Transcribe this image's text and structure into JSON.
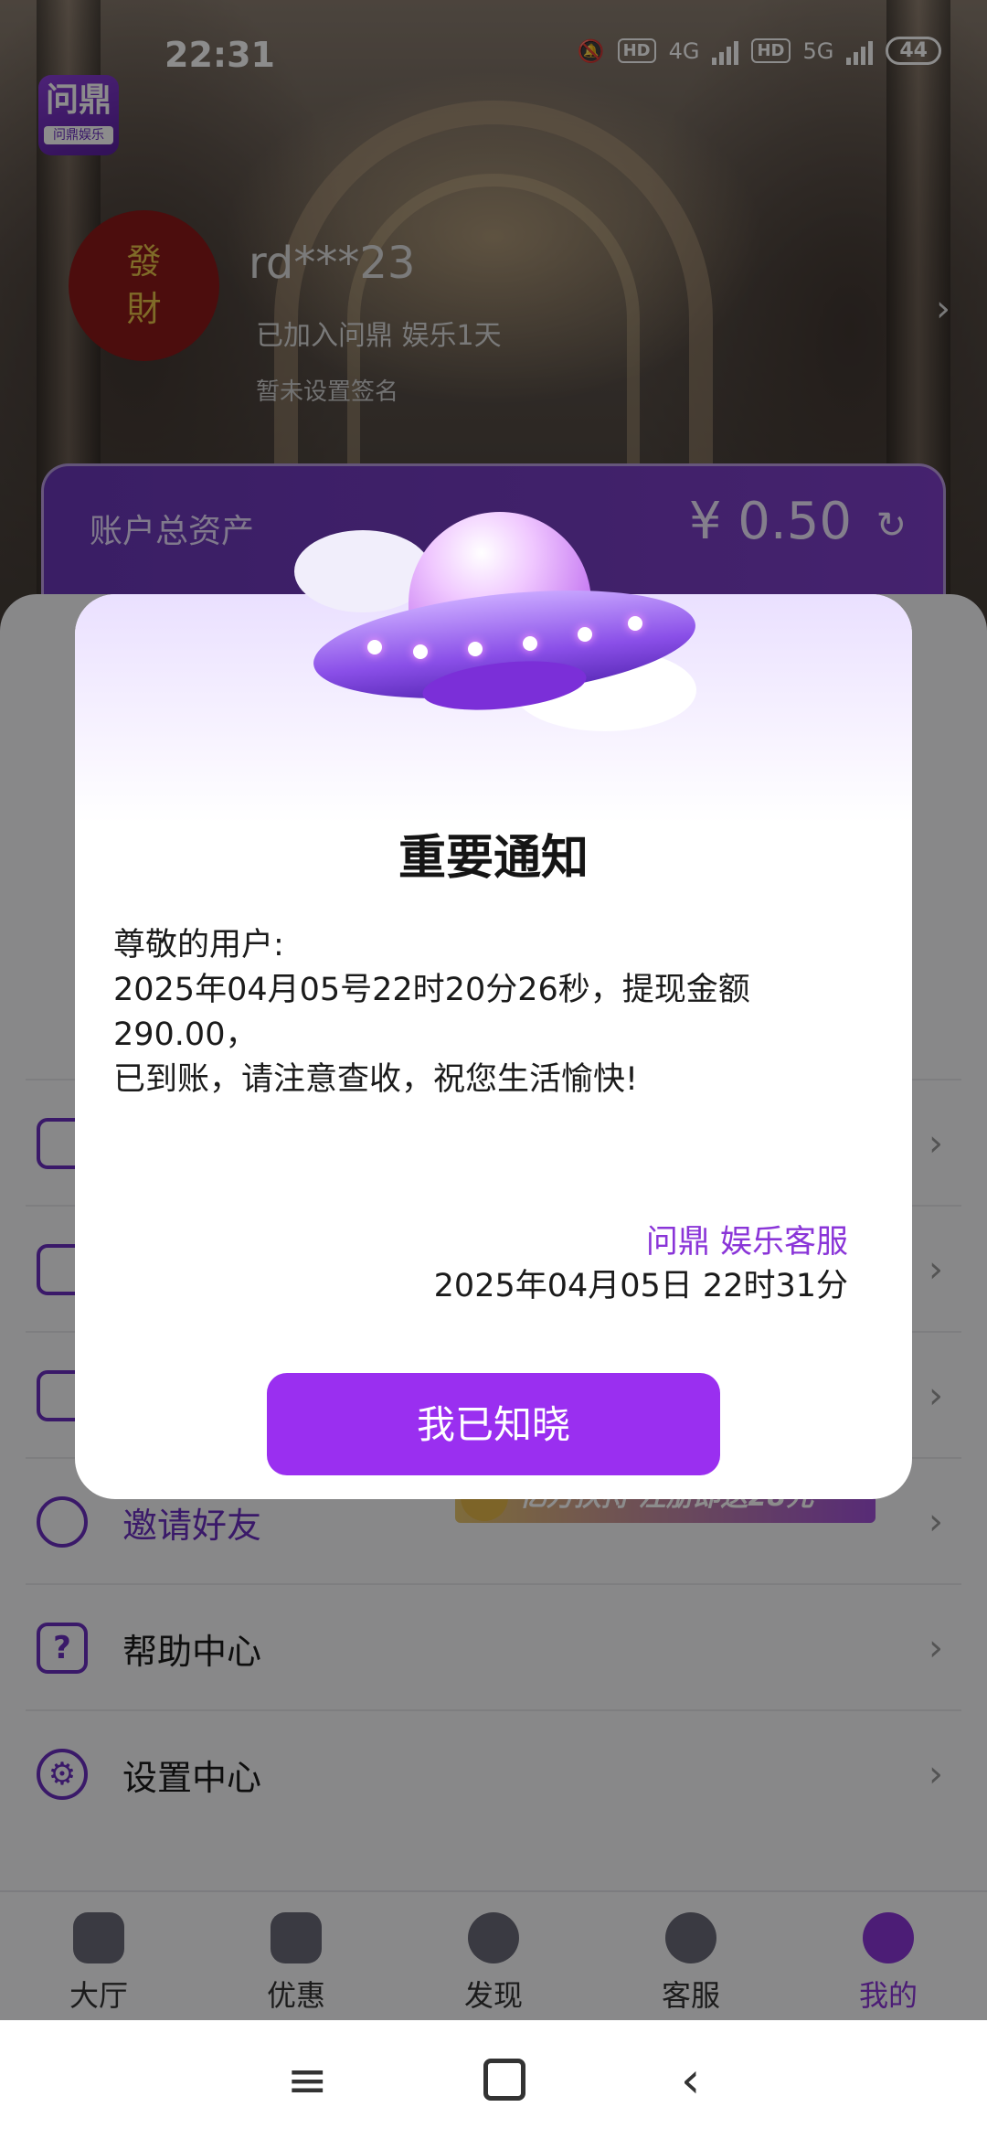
{
  "status_bar": {
    "time": "22:31",
    "hd1": "HD",
    "net1": "4G",
    "hd2": "HD",
    "net2": "5G",
    "battery": "44"
  },
  "app": {
    "logo_main": "问鼎",
    "logo_sub": "问鼎娱乐"
  },
  "profile": {
    "avatar_text": "發財",
    "username": "rd***23",
    "joined": "已加入问鼎 娱乐1天",
    "signature": "暂未设置签名"
  },
  "assets": {
    "label": "账户总资产",
    "value": "¥ 0.50"
  },
  "menu": {
    "invite_label": "邀请好友",
    "invite_banner": "亿万扶持 注册即送28元",
    "help_label": "帮助中心",
    "settings_label": "设置中心"
  },
  "tabs": [
    {
      "label": "大厅"
    },
    {
      "label": "优惠"
    },
    {
      "label": "发现"
    },
    {
      "label": "客服"
    },
    {
      "label": "我的"
    }
  ],
  "dialog": {
    "title": "重要通知",
    "greeting": "尊敬的用户:",
    "body_line1": "2025年04月05号22时20分26秒，提现金额290.00，",
    "body_line2": "已到账，请注意查收，祝您生活愉快!",
    "sign_org": "问鼎 娱乐客服",
    "sign_time": "2025年04月05日 22时31分",
    "confirm_label": "我已知晓"
  },
  "colors": {
    "accent": "#8a35d8",
    "button": "#9a2ff0",
    "card": "#6a38b8"
  }
}
